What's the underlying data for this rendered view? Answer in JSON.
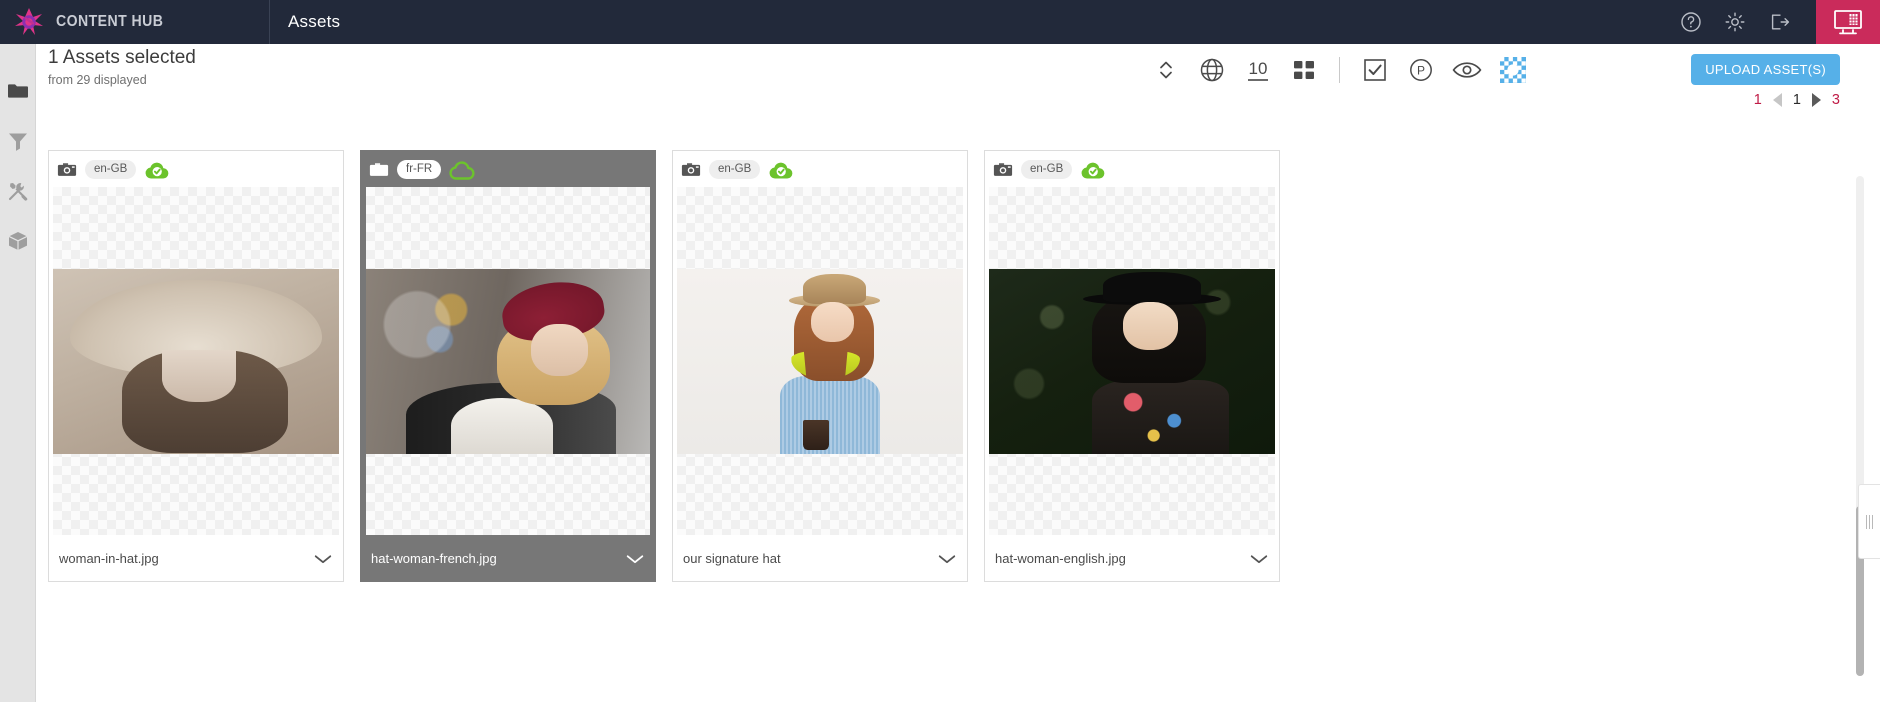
{
  "topbar": {
    "brand": "CONTENT HUB",
    "page": "Assets",
    "icons": {
      "help": "help-circle-icon",
      "settings": "gear-icon",
      "logout": "logout-icon",
      "panel": "dashboard-panel-icon"
    },
    "accent_color": "#ca2b5b",
    "bg_color": "#22293a"
  },
  "rail": {
    "items": [
      {
        "name": "folders",
        "icon": "folder-icon",
        "active": true
      },
      {
        "name": "filters",
        "icon": "funnel-icon",
        "active": false
      },
      {
        "name": "tools",
        "icon": "tools-icon",
        "active": false
      },
      {
        "name": "packages",
        "icon": "box-icon",
        "active": false
      }
    ]
  },
  "header": {
    "title": "1 Assets selected",
    "subtitle": "from 29 displayed"
  },
  "toolbar": {
    "items": [
      {
        "name": "sort",
        "icon": "sort-updown-icon",
        "label": ""
      },
      {
        "name": "language",
        "icon": "globe-icon",
        "label": ""
      },
      {
        "name": "page-size",
        "icon": "page-size-value",
        "label": "10"
      },
      {
        "name": "view-grid",
        "icon": "grid-view-icon",
        "label": ""
      },
      {
        "name": "select-all",
        "icon": "checkbox-checked-icon",
        "label": ""
      },
      {
        "name": "public-link",
        "icon": "circle-p-icon",
        "label": ""
      },
      {
        "name": "preview",
        "icon": "eye-icon",
        "label": ""
      },
      {
        "name": "transparency",
        "icon": "checkerboard-icon",
        "label": ""
      }
    ],
    "upload_label": "UPLOAD ASSET(S)",
    "upload_color": "#56b0e8"
  },
  "pagination": {
    "first": "1",
    "prev": "prev-arrow-icon",
    "current": "1",
    "next": "next-arrow-icon",
    "last": "3",
    "accent": "#c01c47"
  },
  "assets": [
    {
      "filename": "woman-in-hat.jpg",
      "locale": "en-GB",
      "type_icon": "camera-icon",
      "cloud_icon": "cloud-check-icon",
      "cloud_state": "published",
      "selected": false,
      "photo_class": "p1",
      "photo_alt": "black and white woman wearing wide brim sun hat"
    },
    {
      "filename": "hat-woman-french.jpg",
      "locale": "fr-FR",
      "type_icon": "camera-icon",
      "cloud_icon": "cloud-outline-icon",
      "cloud_state": "pending",
      "selected": true,
      "photo_class": "p2",
      "photo_alt": "blonde woman in red beret on a city street"
    },
    {
      "filename": "our signature hat",
      "locale": "en-GB",
      "type_icon": "camera-icon",
      "cloud_icon": "cloud-check-icon",
      "cloud_state": "published",
      "selected": false,
      "photo_class": "p3",
      "photo_alt": "red haired woman in straw hat with headphones holding coffee"
    },
    {
      "filename": "hat-woman-english.jpg",
      "locale": "en-GB",
      "type_icon": "camera-icon",
      "cloud_icon": "cloud-check-icon",
      "cloud_state": "published",
      "selected": false,
      "photo_class": "p4",
      "photo_alt": "dark haired woman in black hat smiling against green background"
    }
  ]
}
